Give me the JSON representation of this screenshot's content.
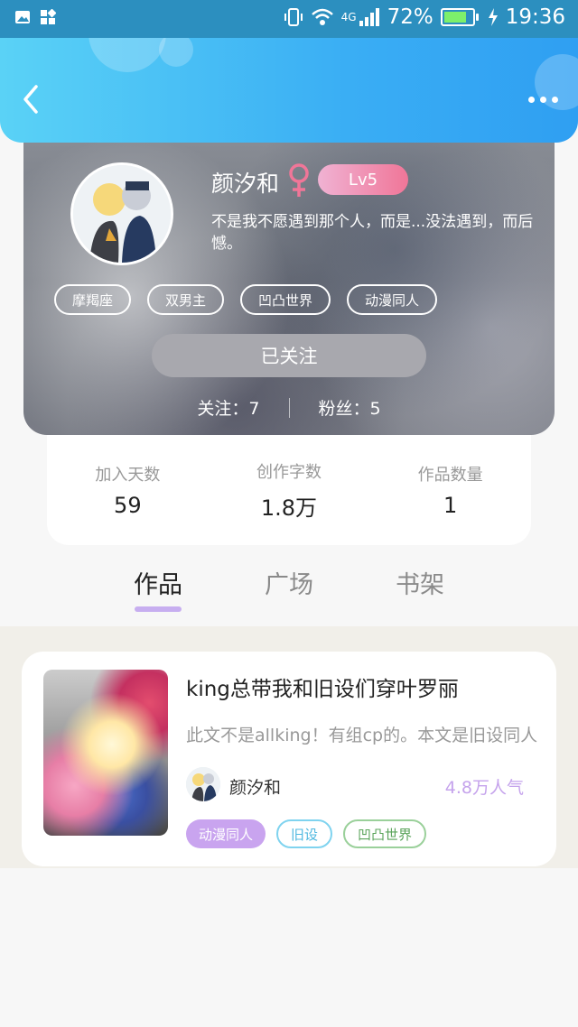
{
  "status_bar": {
    "network": "4G",
    "battery": "72%",
    "battery_level": 0.72,
    "time": "19:36"
  },
  "profile": {
    "name": "颜汐和",
    "gender_icon": "female-icon",
    "level": "Lv5",
    "bio": "不是我不愿遇到那个人，而是...没法遇到，而后\n憾。",
    "tags": [
      "摩羯座",
      "双男主",
      "凹凸世界",
      "动漫同人"
    ],
    "follow_button": "已关注",
    "following": "关注：7",
    "fans": "粉丝：5"
  },
  "stats": [
    {
      "label": "加入天数",
      "value": "59"
    },
    {
      "label": "创作字数",
      "value": "1.8万"
    },
    {
      "label": "作品数量",
      "value": "1"
    }
  ],
  "tabs": [
    "作品",
    "广场",
    "书架"
  ],
  "active_tab": 0,
  "works": [
    {
      "title": "king总带我和旧设们穿叶罗丽",
      "description": "此文不是allking！有组cp的。本文是旧设同人",
      "author": "颜汐和",
      "popularity": "4.8万人气",
      "tags": [
        "动漫同人",
        "旧设",
        "凹凸世界"
      ]
    }
  ],
  "colors": {
    "header_start": "#5ad2f6",
    "header_end": "#2f9ff2",
    "accent_purple": "#c7aef0",
    "level_badge": "#f07698"
  }
}
